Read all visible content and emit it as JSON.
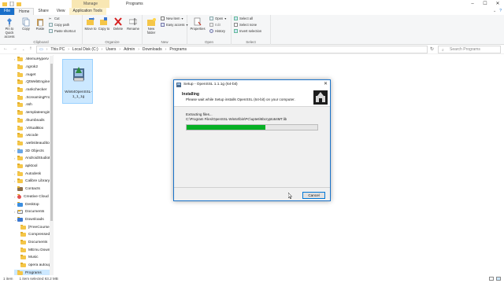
{
  "window": {
    "manage_tab": "Manage",
    "title": "Programs",
    "minimize": "–",
    "maximize": "☐",
    "close": "✕"
  },
  "tabs": {
    "file": "File",
    "home": "Home",
    "share": "Share",
    "view": "View",
    "application_tools": "Application Tools"
  },
  "ribbon": {
    "pin": "Pin to Quick access",
    "copy": "Copy",
    "paste": "Paste",
    "cut": "Cut",
    "copy_path": "Copy path",
    "paste_shortcut": "Paste shortcut",
    "clipboard": "Clipboard",
    "move_to": "Move to",
    "copy_to": "Copy to",
    "delete": "Delete",
    "rename": "Rename",
    "organize": "Organize",
    "new_folder": "New folder",
    "new_item": "New item",
    "easy_access": "Easy access",
    "new": "New",
    "properties": "Properties",
    "open": "Open",
    "edit": "Edit",
    "history": "History",
    "open_group": "Open",
    "select_all": "Select all",
    "select_none": "Select none",
    "invert_selection": "Invert selection",
    "select": "Select"
  },
  "address": {
    "segments": [
      "This PC",
      "Local Disk (C:)",
      "Users",
      "Admin",
      "Downloads",
      "Programs"
    ],
    "search_placeholder": "Search Programs"
  },
  "sidebar": {
    "items": [
      ".MemuHyperv",
      ".ngrok2",
      ".nuget",
      ".QtWebEngineP",
      ".rankchecker",
      ".ScreamingFrog",
      ".ssh",
      ".templateengine",
      ".thumbnails",
      ".VirtualBox",
      ".vscode",
      ".websiteauditor",
      "3D Objects",
      "AndroidStudioP",
      "apktool",
      "Autodesk",
      "Calibre Library",
      "Contacts",
      "Creative Cloud",
      "Desktop",
      "Documents",
      "Downloads",
      "[FreeCourseSit",
      "Compressed",
      "Documents",
      "MEmu Downlo",
      "Music",
      "opera autoupd",
      "Programs"
    ]
  },
  "content": {
    "file_name": "Win64OpenSSL-1_1_1g"
  },
  "status": {
    "items": "1 item",
    "selected": "1 item selected 63.2 MB"
  },
  "dialog": {
    "title": "Setup - OpenSSL 1.1.1g (64-bit)",
    "close": "✕",
    "heading": "Installing",
    "subheading": "Please wait while Setup installs OpenSSL (64-bit) on your computer.",
    "extracting": "Extracting files...",
    "path": "C:\\Program Files\\OpenSSL-Win64\\bin\\PC\\upte6\\6bcrypto64MT.lib",
    "progress": 0.6,
    "cancel": "Cancel"
  },
  "colors": {
    "accent": "#1a6fc9",
    "progress": "#06b025",
    "selection": "#cce8ff",
    "folder": "#f5c648"
  }
}
